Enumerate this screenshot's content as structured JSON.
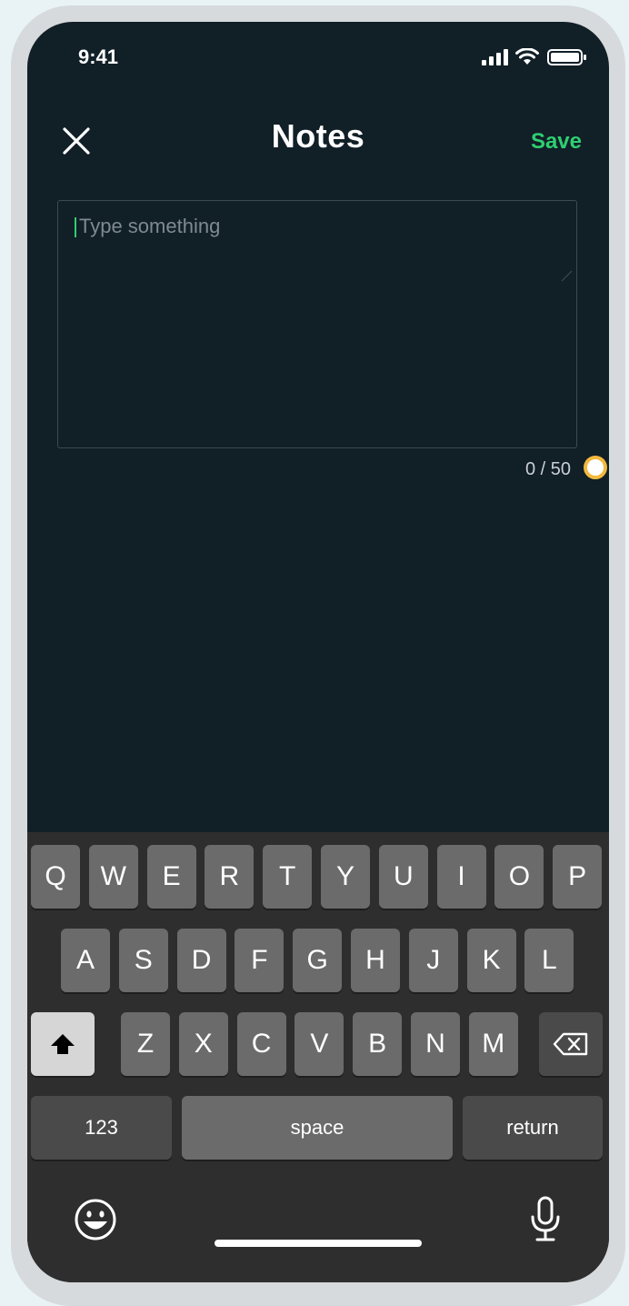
{
  "status_bar": {
    "time": "9:41",
    "signal_icon": "cellular-signal-icon",
    "wifi_icon": "wifi-icon",
    "battery_icon": "battery-icon"
  },
  "header": {
    "close_icon": "close-icon",
    "title": "Notes",
    "save_label": "Save"
  },
  "note": {
    "value": "",
    "placeholder": "Type something",
    "counter": "0 / 50"
  },
  "colors": {
    "background": "#111f27",
    "accent": "#2fce71",
    "marker": "#f3b93e"
  },
  "keyboard": {
    "row1": [
      "Q",
      "W",
      "E",
      "R",
      "T",
      "Y",
      "U",
      "I",
      "O",
      "P"
    ],
    "row2": [
      "A",
      "S",
      "D",
      "F",
      "G",
      "H",
      "J",
      "K",
      "L"
    ],
    "row3": [
      "Z",
      "X",
      "C",
      "V",
      "B",
      "N",
      "M"
    ],
    "shift_icon": "shift-arrow-icon",
    "backspace_icon": "backspace-icon",
    "numbers_label": "123",
    "space_label": "space",
    "return_label": "return",
    "emoji_icon": "emoji-icon",
    "mic_icon": "microphone-icon"
  }
}
